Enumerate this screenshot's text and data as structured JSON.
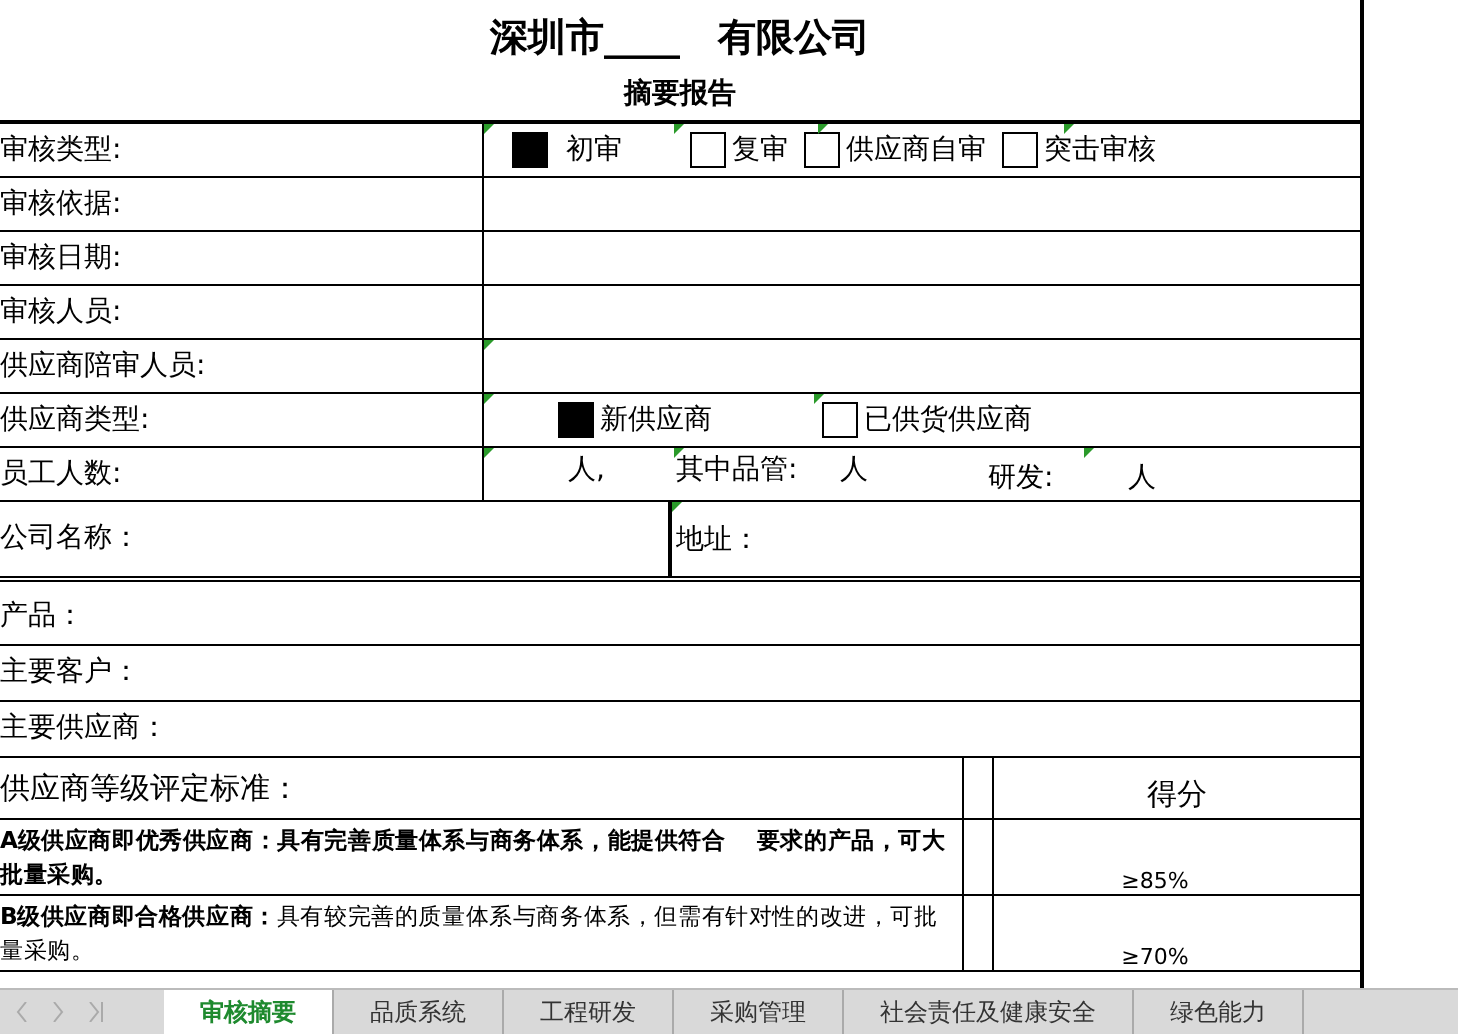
{
  "title": "深圳市____　有限公司",
  "subtitle": "摘要报告",
  "fields": [
    {
      "kind": "options",
      "label": "审核类型:",
      "options": [
        {
          "label": "初审",
          "checked": true
        },
        {
          "label": "复审",
          "checked": false
        },
        {
          "label": "供应商自审",
          "checked": false
        },
        {
          "label": "突击审核",
          "checked": false
        }
      ]
    },
    {
      "kind": "blank",
      "label": "审核依据:"
    },
    {
      "kind": "blank",
      "label": "审核日期:"
    },
    {
      "kind": "blank",
      "label": "审核人员:"
    },
    {
      "kind": "blank",
      "label": "供应商陪审人员:"
    },
    {
      "kind": "options",
      "label": "供应商类型:",
      "options": [
        {
          "label": "新供应商",
          "checked": true
        },
        {
          "label": "已供货供应商",
          "checked": false
        }
      ]
    },
    {
      "kind": "staff",
      "label": "员工人数:",
      "parts": [
        "人,",
        "其中品管:",
        "人",
        "研发:",
        "人"
      ]
    },
    {
      "kind": "split",
      "label": "公司名称：",
      "right": "地址："
    }
  ],
  "info_rows": [
    "产品：",
    "主要客户：",
    "主要供应商："
  ],
  "grading": {
    "heading": "供应商等级评定标准：",
    "score_heading": "得分",
    "levels": [
      {
        "text": "A级供应商即优秀供应商：具有完善质量体系与商务体系，能提供符合　 要求的产品，可大批量采购。",
        "bold": true,
        "score": "≥85%"
      },
      {
        "text": "**B级供应商即合格供应商：**具有较完善的质量体系与商务体系，但需有针对性的改进，可批量采购。",
        "bold": false,
        "score": "≥70%"
      }
    ]
  },
  "sheet_tabs": [
    {
      "label": "审核摘要",
      "selected": true
    },
    {
      "label": "品质系统",
      "selected": false
    },
    {
      "label": "工程研发",
      "selected": false
    },
    {
      "label": "采购管理",
      "selected": false
    },
    {
      "label": "社会责任及健康安全",
      "selected": false
    },
    {
      "label": "绿色能力",
      "selected": false
    }
  ]
}
